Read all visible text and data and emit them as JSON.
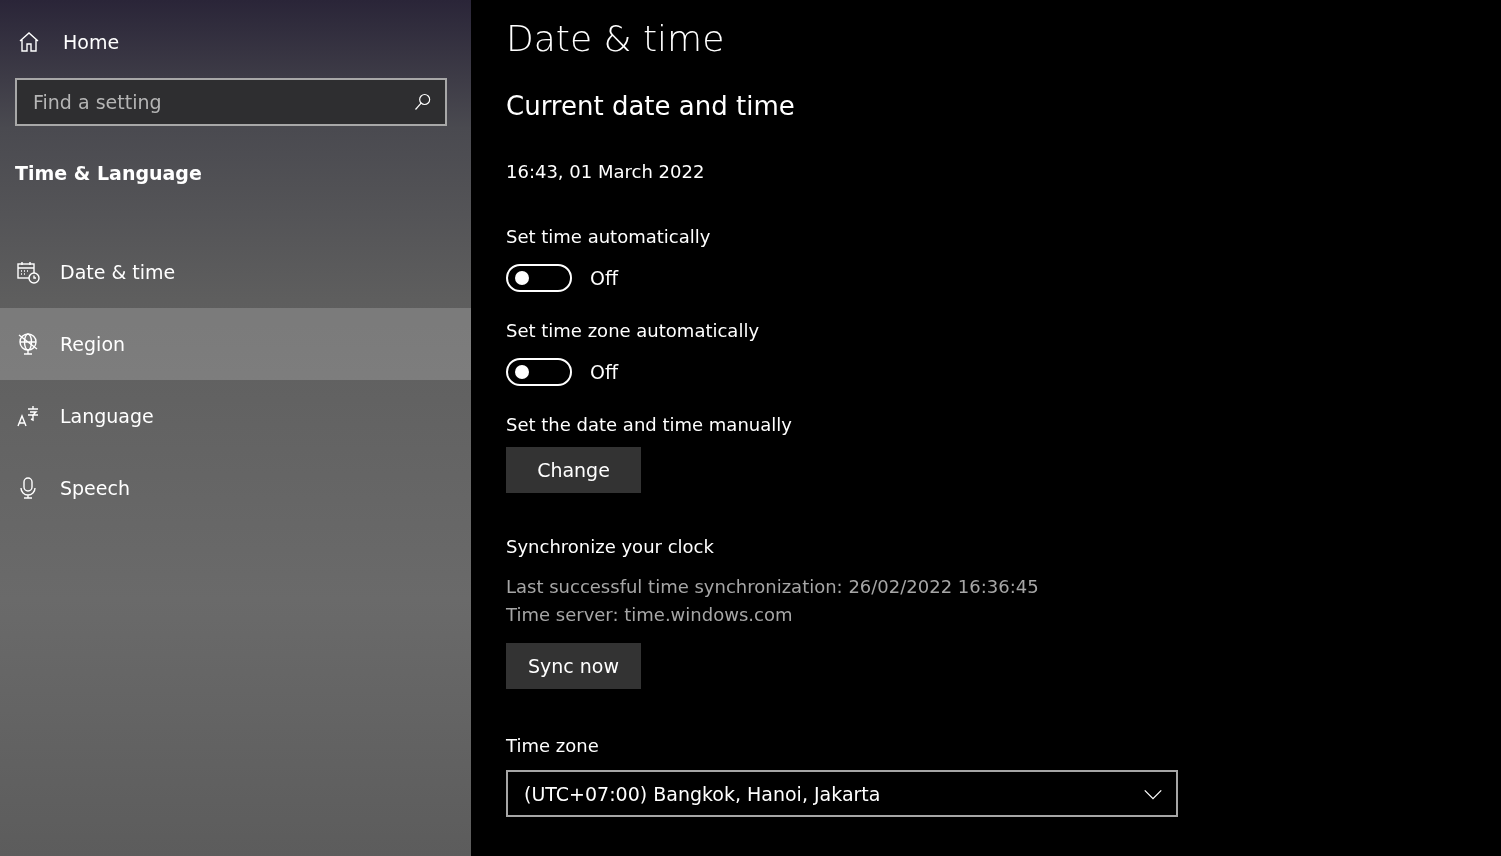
{
  "sidebar": {
    "home": "Home",
    "search": {
      "placeholder": "Find a setting"
    },
    "section_title": "Time & Language",
    "items": [
      {
        "label": "Date & time",
        "selected": false
      },
      {
        "label": "Region",
        "selected": true
      },
      {
        "label": "Language",
        "selected": false
      },
      {
        "label": "Speech",
        "selected": false
      }
    ]
  },
  "main": {
    "title": "Date & time",
    "subtitle": "Current date and time",
    "current": "16:43, 01 March 2022",
    "toggles": [
      {
        "label": "Set time automatically",
        "on": false,
        "state": "Off"
      },
      {
        "label": "Set time zone automatically",
        "on": false,
        "state": "Off"
      }
    ],
    "manual": {
      "label": "Set the date and time manually",
      "button": "Change"
    },
    "sync": {
      "title": "Synchronize your clock",
      "last": "Last successful time synchronization: 26/02/2022 16:36:45",
      "server": "Time server: time.windows.com",
      "button": "Sync now"
    },
    "time_zone": {
      "label": "Time zone",
      "value": "(UTC+07:00) Bangkok, Hanoi, Jakarta"
    }
  }
}
